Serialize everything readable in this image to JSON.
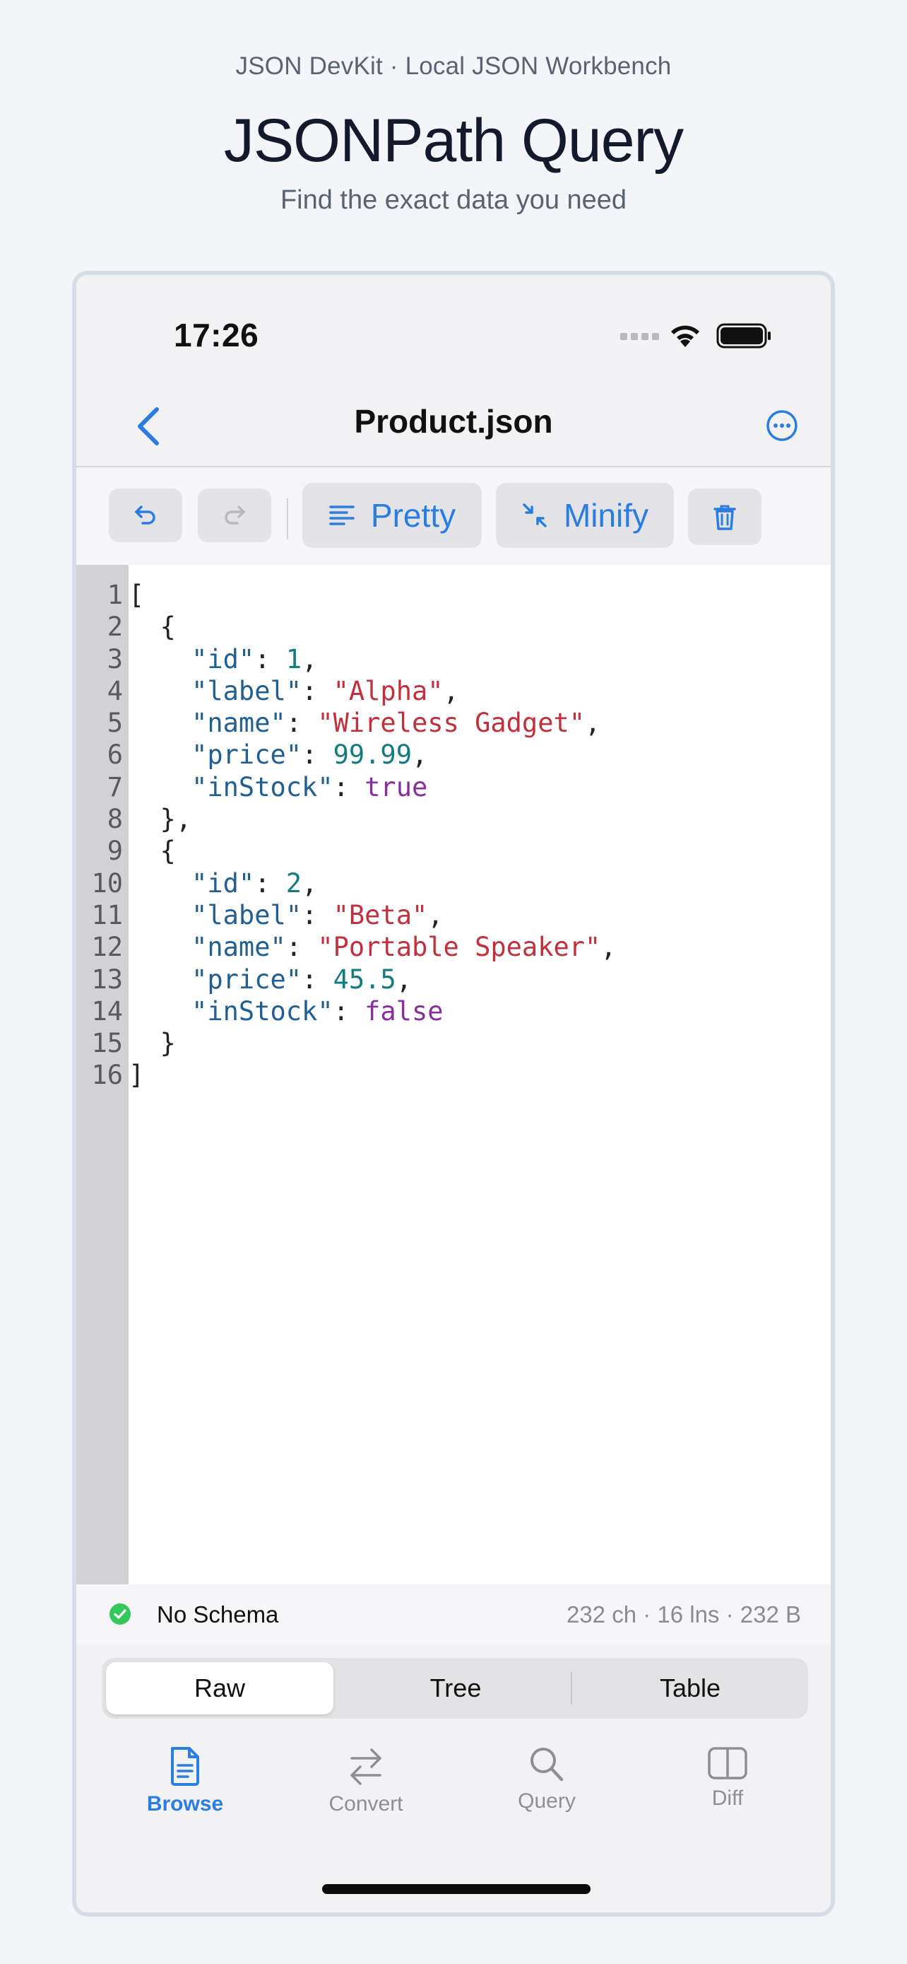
{
  "header": {
    "tagline": "JSON DevKit · Local JSON Workbench",
    "title": "JSONPath Query",
    "subtitle": "Find the exact data you need"
  },
  "status_bar": {
    "time": "17:26"
  },
  "navbar": {
    "title": "Product.json",
    "back_icon": "chevron-left-icon",
    "more_icon": "ellipsis-circle-icon"
  },
  "toolbar": {
    "undo_icon": "undo-icon",
    "redo_icon": "redo-icon",
    "pretty_label": "Pretty",
    "minify_label": "Minify",
    "delete_icon": "trash-icon"
  },
  "editor": {
    "lines": [
      [
        "1",
        "["
      ],
      [
        "2",
        "  {"
      ],
      [
        "3",
        "    \"id\": 1,"
      ],
      [
        "4",
        "    \"label\": \"Alpha\","
      ],
      [
        "5",
        "    \"name\": \"Wireless Gadget\","
      ],
      [
        "6",
        "    \"price\": 99.99,"
      ],
      [
        "7",
        "    \"inStock\": true"
      ],
      [
        "8",
        "  },"
      ],
      [
        "9",
        "  {"
      ],
      [
        "10",
        "    \"id\": 2,"
      ],
      [
        "11",
        "    \"label\": \"Beta\","
      ],
      [
        "12",
        "    \"name\": \"Portable Speaker\","
      ],
      [
        "13",
        "    \"price\": 45.5,"
      ],
      [
        "14",
        "    \"inStock\": false"
      ],
      [
        "15",
        "  }"
      ],
      [
        "16",
        "]"
      ]
    ]
  },
  "footer": {
    "schema_label": "No Schema",
    "stats": "232 ch · 16 lns · 232 B"
  },
  "segments": [
    {
      "label": "Raw",
      "active": true
    },
    {
      "label": "Tree",
      "active": false
    },
    {
      "label": "Table",
      "active": false
    }
  ],
  "tabs": [
    {
      "label": "Browse",
      "icon": "document-icon",
      "active": true
    },
    {
      "label": "Convert",
      "icon": "arrows-left-right-icon",
      "active": false
    },
    {
      "label": "Query",
      "icon": "magnifier-icon",
      "active": false
    },
    {
      "label": "Diff",
      "icon": "split-view-icon",
      "active": false
    }
  ],
  "colors": {
    "accent": "#2a7de1",
    "json_key": "#1f5f93",
    "json_string": "#c1303c",
    "json_number": "#137c80",
    "json_bool": "#8a2da0",
    "schema_ok": "#34c759",
    "inactive_tab": "#8e8e93"
  }
}
